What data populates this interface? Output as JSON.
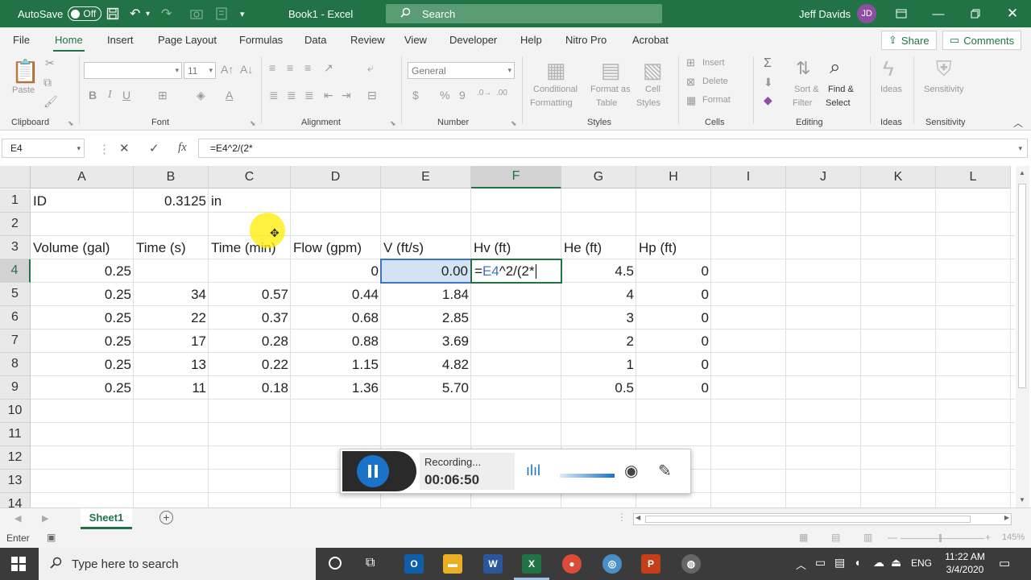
{
  "titlebar": {
    "autosave_label": "AutoSave",
    "autosave_state": "Off",
    "doc_title": "Book1  -  Excel",
    "search_placeholder": "Search",
    "user_name": "Jeff Davids",
    "user_initials": "JD"
  },
  "menu": {
    "items": [
      "File",
      "Home",
      "Insert",
      "Page Layout",
      "Formulas",
      "Data",
      "Review",
      "View",
      "Developer",
      "Help",
      "Nitro Pro",
      "Acrobat"
    ],
    "active": "Home",
    "share_label": "Share",
    "comments_label": "Comments"
  },
  "ribbon": {
    "clipboard": {
      "label": "Clipboard",
      "paste": "Paste"
    },
    "font": {
      "label": "Font",
      "size": "11"
    },
    "alignment": {
      "label": "Alignment"
    },
    "number": {
      "label": "Number",
      "format": "General"
    },
    "styles": {
      "label": "Styles",
      "conditional": "Conditional",
      "conditional2": "Formatting",
      "format_table": "Format as",
      "format_table2": "Table",
      "cell_styles": "Cell",
      "cell_styles2": "Styles"
    },
    "cells": {
      "label": "Cells",
      "insert": "Insert",
      "delete": "Delete",
      "format": "Format"
    },
    "editing": {
      "label": "Editing",
      "sort": "Sort &",
      "sort2": "Filter",
      "find": "Find &",
      "find2": "Select"
    },
    "ideas": {
      "label": "Ideas",
      "button": "Ideas"
    },
    "sensitivity": {
      "label": "Sensitivity",
      "button": "Sensitivity"
    }
  },
  "formula_bar": {
    "name_box": "E4",
    "formula": "=E4^2/(2*"
  },
  "sheet": {
    "columns": [
      "A",
      "B",
      "C",
      "D",
      "E",
      "F",
      "G",
      "H",
      "I",
      "J",
      "K",
      "L"
    ],
    "rows": [
      "1",
      "2",
      "3",
      "4",
      "5",
      "6",
      "7",
      "8",
      "9",
      "10",
      "11",
      "12",
      "13",
      "14"
    ],
    "r1": {
      "a": "ID",
      "b": "0.3125",
      "c": "in"
    },
    "headers": {
      "a": "Volume (gal)",
      "b": "Time (s)",
      "c": "Time (min)",
      "d": "Flow (gpm)",
      "e": "V (ft/s)",
      "f": "Hv (ft)",
      "g": "He (ft)",
      "h": "Hp (ft)"
    },
    "data": [
      {
        "a": "0.25",
        "b": "",
        "c": "",
        "d": "0",
        "e": "0.00",
        "g": "4.5",
        "h": "0"
      },
      {
        "a": "0.25",
        "b": "34",
        "c": "0.57",
        "d": "0.44",
        "e": "1.84",
        "g": "4",
        "h": "0"
      },
      {
        "a": "0.25",
        "b": "22",
        "c": "0.37",
        "d": "0.68",
        "e": "2.85",
        "g": "3",
        "h": "0"
      },
      {
        "a": "0.25",
        "b": "17",
        "c": "0.28",
        "d": "0.88",
        "e": "3.69",
        "g": "2",
        "h": "0"
      },
      {
        "a": "0.25",
        "b": "13",
        "c": "0.22",
        "d": "1.15",
        "e": "4.82",
        "g": "1",
        "h": "0"
      },
      {
        "a": "0.25",
        "b": "11",
        "c": "0.18",
        "d": "1.36",
        "e": "5.70",
        "g": "0.5",
        "h": "0"
      }
    ],
    "edit_cell": {
      "ref": "E4",
      "rest": "^2/(2*",
      "prefix": "="
    }
  },
  "sheet_tabs": {
    "active": "Sheet1"
  },
  "status": {
    "mode": "Enter",
    "zoom": "145%"
  },
  "recorder": {
    "status": "Recording...",
    "time": "00:06:50"
  },
  "taskbar": {
    "search_placeholder": "Type here to search",
    "lang": "ENG",
    "time": "11:22 AM",
    "date": "3/4/2020"
  },
  "colors": {
    "excel_green": "#217346",
    "ref_blue": "#3e74c4",
    "highlight": "#ffec00"
  }
}
